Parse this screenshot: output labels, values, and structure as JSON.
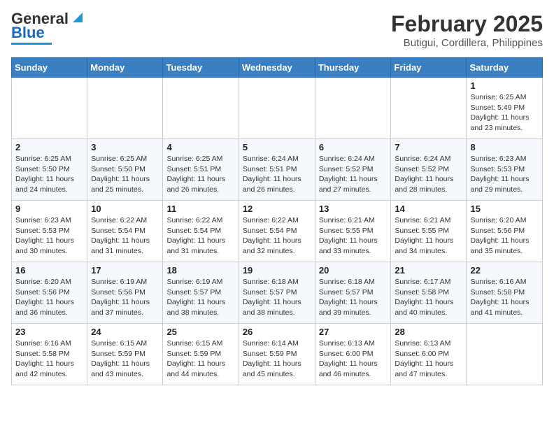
{
  "header": {
    "logo_general": "General",
    "logo_blue": "Blue",
    "title": "February 2025",
    "subtitle": "Butigui, Cordillera, Philippines"
  },
  "weekdays": [
    "Sunday",
    "Monday",
    "Tuesday",
    "Wednesday",
    "Thursday",
    "Friday",
    "Saturday"
  ],
  "weeks": [
    [
      {
        "day": "",
        "info": ""
      },
      {
        "day": "",
        "info": ""
      },
      {
        "day": "",
        "info": ""
      },
      {
        "day": "",
        "info": ""
      },
      {
        "day": "",
        "info": ""
      },
      {
        "day": "",
        "info": ""
      },
      {
        "day": "1",
        "info": "Sunrise: 6:25 AM\nSunset: 5:49 PM\nDaylight: 11 hours\nand 23 minutes."
      }
    ],
    [
      {
        "day": "2",
        "info": "Sunrise: 6:25 AM\nSunset: 5:50 PM\nDaylight: 11 hours\nand 24 minutes."
      },
      {
        "day": "3",
        "info": "Sunrise: 6:25 AM\nSunset: 5:50 PM\nDaylight: 11 hours\nand 25 minutes."
      },
      {
        "day": "4",
        "info": "Sunrise: 6:25 AM\nSunset: 5:51 PM\nDaylight: 11 hours\nand 26 minutes."
      },
      {
        "day": "5",
        "info": "Sunrise: 6:24 AM\nSunset: 5:51 PM\nDaylight: 11 hours\nand 26 minutes."
      },
      {
        "day": "6",
        "info": "Sunrise: 6:24 AM\nSunset: 5:52 PM\nDaylight: 11 hours\nand 27 minutes."
      },
      {
        "day": "7",
        "info": "Sunrise: 6:24 AM\nSunset: 5:52 PM\nDaylight: 11 hours\nand 28 minutes."
      },
      {
        "day": "8",
        "info": "Sunrise: 6:23 AM\nSunset: 5:53 PM\nDaylight: 11 hours\nand 29 minutes."
      }
    ],
    [
      {
        "day": "9",
        "info": "Sunrise: 6:23 AM\nSunset: 5:53 PM\nDaylight: 11 hours\nand 30 minutes."
      },
      {
        "day": "10",
        "info": "Sunrise: 6:22 AM\nSunset: 5:54 PM\nDaylight: 11 hours\nand 31 minutes."
      },
      {
        "day": "11",
        "info": "Sunrise: 6:22 AM\nSunset: 5:54 PM\nDaylight: 11 hours\nand 31 minutes."
      },
      {
        "day": "12",
        "info": "Sunrise: 6:22 AM\nSunset: 5:54 PM\nDaylight: 11 hours\nand 32 minutes."
      },
      {
        "day": "13",
        "info": "Sunrise: 6:21 AM\nSunset: 5:55 PM\nDaylight: 11 hours\nand 33 minutes."
      },
      {
        "day": "14",
        "info": "Sunrise: 6:21 AM\nSunset: 5:55 PM\nDaylight: 11 hours\nand 34 minutes."
      },
      {
        "day": "15",
        "info": "Sunrise: 6:20 AM\nSunset: 5:56 PM\nDaylight: 11 hours\nand 35 minutes."
      }
    ],
    [
      {
        "day": "16",
        "info": "Sunrise: 6:20 AM\nSunset: 5:56 PM\nDaylight: 11 hours\nand 36 minutes."
      },
      {
        "day": "17",
        "info": "Sunrise: 6:19 AM\nSunset: 5:56 PM\nDaylight: 11 hours\nand 37 minutes."
      },
      {
        "day": "18",
        "info": "Sunrise: 6:19 AM\nSunset: 5:57 PM\nDaylight: 11 hours\nand 38 minutes."
      },
      {
        "day": "19",
        "info": "Sunrise: 6:18 AM\nSunset: 5:57 PM\nDaylight: 11 hours\nand 38 minutes."
      },
      {
        "day": "20",
        "info": "Sunrise: 6:18 AM\nSunset: 5:57 PM\nDaylight: 11 hours\nand 39 minutes."
      },
      {
        "day": "21",
        "info": "Sunrise: 6:17 AM\nSunset: 5:58 PM\nDaylight: 11 hours\nand 40 minutes."
      },
      {
        "day": "22",
        "info": "Sunrise: 6:16 AM\nSunset: 5:58 PM\nDaylight: 11 hours\nand 41 minutes."
      }
    ],
    [
      {
        "day": "23",
        "info": "Sunrise: 6:16 AM\nSunset: 5:58 PM\nDaylight: 11 hours\nand 42 minutes."
      },
      {
        "day": "24",
        "info": "Sunrise: 6:15 AM\nSunset: 5:59 PM\nDaylight: 11 hours\nand 43 minutes."
      },
      {
        "day": "25",
        "info": "Sunrise: 6:15 AM\nSunset: 5:59 PM\nDaylight: 11 hours\nand 44 minutes."
      },
      {
        "day": "26",
        "info": "Sunrise: 6:14 AM\nSunset: 5:59 PM\nDaylight: 11 hours\nand 45 minutes."
      },
      {
        "day": "27",
        "info": "Sunrise: 6:13 AM\nSunset: 6:00 PM\nDaylight: 11 hours\nand 46 minutes."
      },
      {
        "day": "28",
        "info": "Sunrise: 6:13 AM\nSunset: 6:00 PM\nDaylight: 11 hours\nand 47 minutes."
      },
      {
        "day": "",
        "info": ""
      }
    ]
  ]
}
